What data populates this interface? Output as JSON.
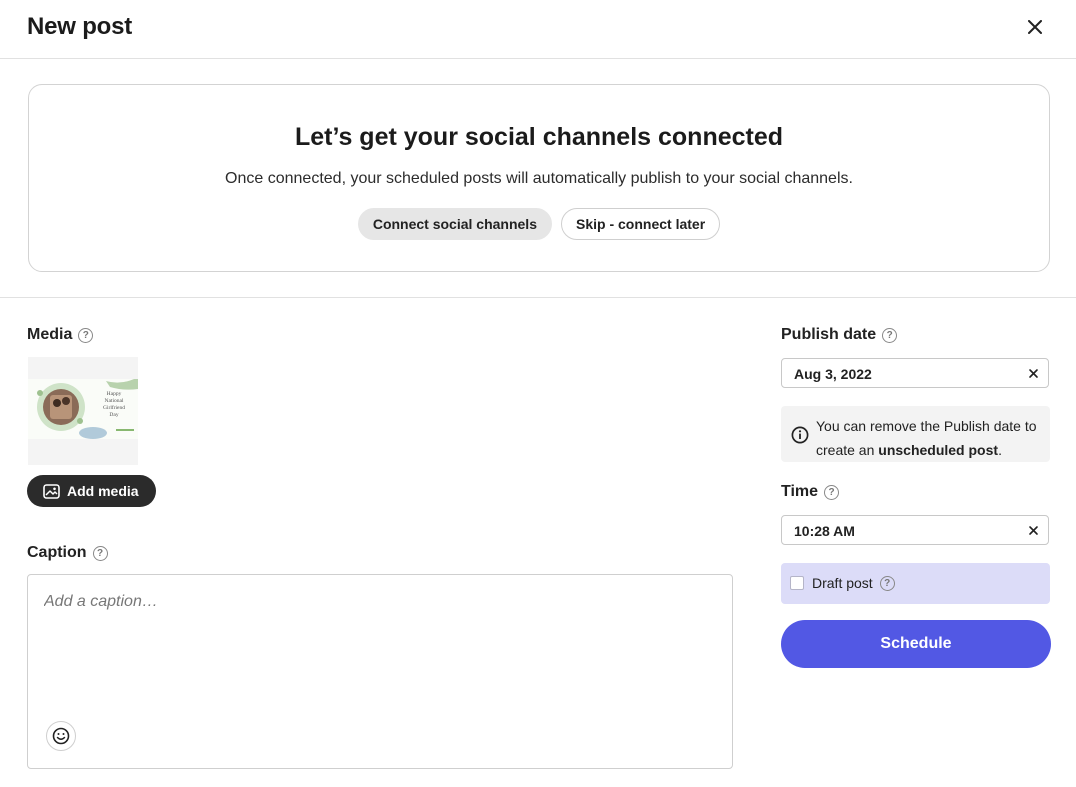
{
  "header": {
    "title": "New post"
  },
  "banner": {
    "heading": "Let’s get your social channels connected",
    "subtext": "Once connected, your scheduled posts will automatically publish to your social channels.",
    "connect_label": "Connect social channels",
    "skip_label": "Skip - connect later"
  },
  "media": {
    "label": "Media",
    "thumbnail_text": "Happy National Girlfriend Day",
    "add_label": "Add media"
  },
  "caption": {
    "label": "Caption",
    "placeholder": "Add a caption…"
  },
  "publish_date": {
    "label": "Publish date",
    "value": "Aug 3, 2022"
  },
  "info": {
    "text_before": "You can remove the Publish date to create an ",
    "text_bold": "unscheduled post",
    "text_after": "."
  },
  "time": {
    "label": "Time",
    "value": "10:28 AM"
  },
  "draft": {
    "label": "Draft post",
    "checked": false
  },
  "schedule_label": "Schedule",
  "colors": {
    "accent": "#5258e4",
    "draft_bg": "#dcdcf8",
    "dark_button": "#2b2b2b"
  },
  "icons": [
    "close-icon",
    "help-icon",
    "image-icon",
    "info-icon",
    "smiley-icon",
    "clear-icon"
  ]
}
